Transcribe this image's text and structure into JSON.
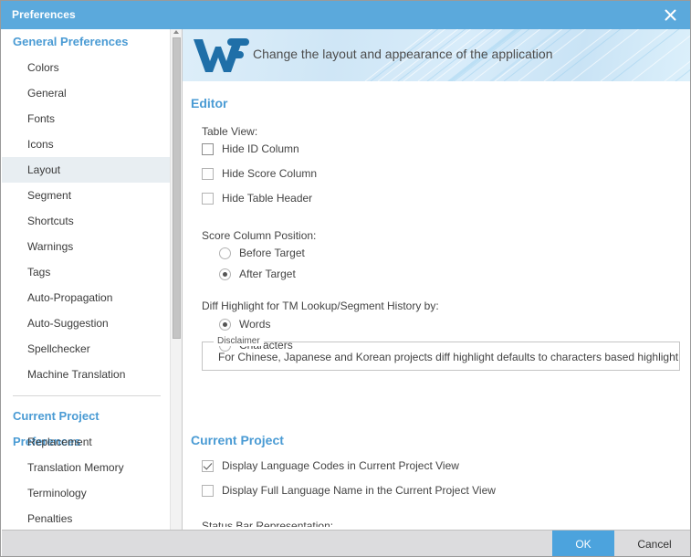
{
  "window": {
    "title": "Preferences",
    "close_icon": "close-icon"
  },
  "sidebar": {
    "groups": [
      {
        "title": "General Preferences",
        "items": [
          {
            "label": "Colors",
            "selected": false
          },
          {
            "label": "General",
            "selected": false
          },
          {
            "label": "Fonts",
            "selected": false
          },
          {
            "label": "Icons",
            "selected": false
          },
          {
            "label": "Layout",
            "selected": true
          },
          {
            "label": "Segment",
            "selected": false
          },
          {
            "label": "Shortcuts",
            "selected": false
          },
          {
            "label": "Warnings",
            "selected": false
          },
          {
            "label": "Tags",
            "selected": false
          },
          {
            "label": "Auto-Propagation",
            "selected": false
          },
          {
            "label": "Auto-Suggestion",
            "selected": false
          },
          {
            "label": "Spellchecker",
            "selected": false
          },
          {
            "label": "Machine Translation",
            "selected": false
          }
        ]
      },
      {
        "title": "Current Project Preferences",
        "items": [
          {
            "label": "Replacement",
            "selected": false
          },
          {
            "label": "Translation Memory",
            "selected": false
          },
          {
            "label": "Terminology",
            "selected": false
          },
          {
            "label": "Penalties",
            "selected": false
          }
        ]
      }
    ],
    "scrollbar": "sidebar-scrollbar"
  },
  "banner": {
    "logo_alt": "wordfast-logo",
    "text": "Change the layout and appearance of the application"
  },
  "editor": {
    "heading": "Editor",
    "table_view_label": "Table View:",
    "table_view_options": [
      {
        "label": "Hide ID Column",
        "checked": false,
        "focused": true
      },
      {
        "label": "Hide Score Column",
        "checked": false,
        "focused": false
      },
      {
        "label": "Hide Table Header",
        "checked": false,
        "focused": false
      }
    ],
    "score_position_label": "Score Column Position:",
    "score_position_options": [
      {
        "label": "Before Target",
        "selected": false
      },
      {
        "label": "After Target",
        "selected": true
      }
    ],
    "diff_label": "Diff Highlight for TM Lookup/Segment History by:",
    "diff_options": [
      {
        "label": "Words",
        "selected": true
      },
      {
        "label": "Characters",
        "selected": false
      }
    ],
    "disclaimer_legend": "Disclaimer",
    "disclaimer_text": "For Chinese, Japanese and Korean projects diff highlight defaults to characters based highlight"
  },
  "current_project": {
    "heading": "Current Project",
    "options": [
      {
        "label": "Display Language Codes in Current Project View",
        "checked": true
      },
      {
        "label": "Display Full Language Name in the Current Project View",
        "checked": false
      }
    ],
    "cutoff_label": "Status Bar Representation:"
  },
  "footer": {
    "ok_label": "OK",
    "cancel_label": "Cancel"
  },
  "colors": {
    "titlebar": "#5ba9dc",
    "accent": "#4a9bd4",
    "ok_button": "#4ca3dd",
    "footer": "#dcdcde",
    "selected_row": "#e8eef2",
    "logo": "#1f6fa8"
  }
}
